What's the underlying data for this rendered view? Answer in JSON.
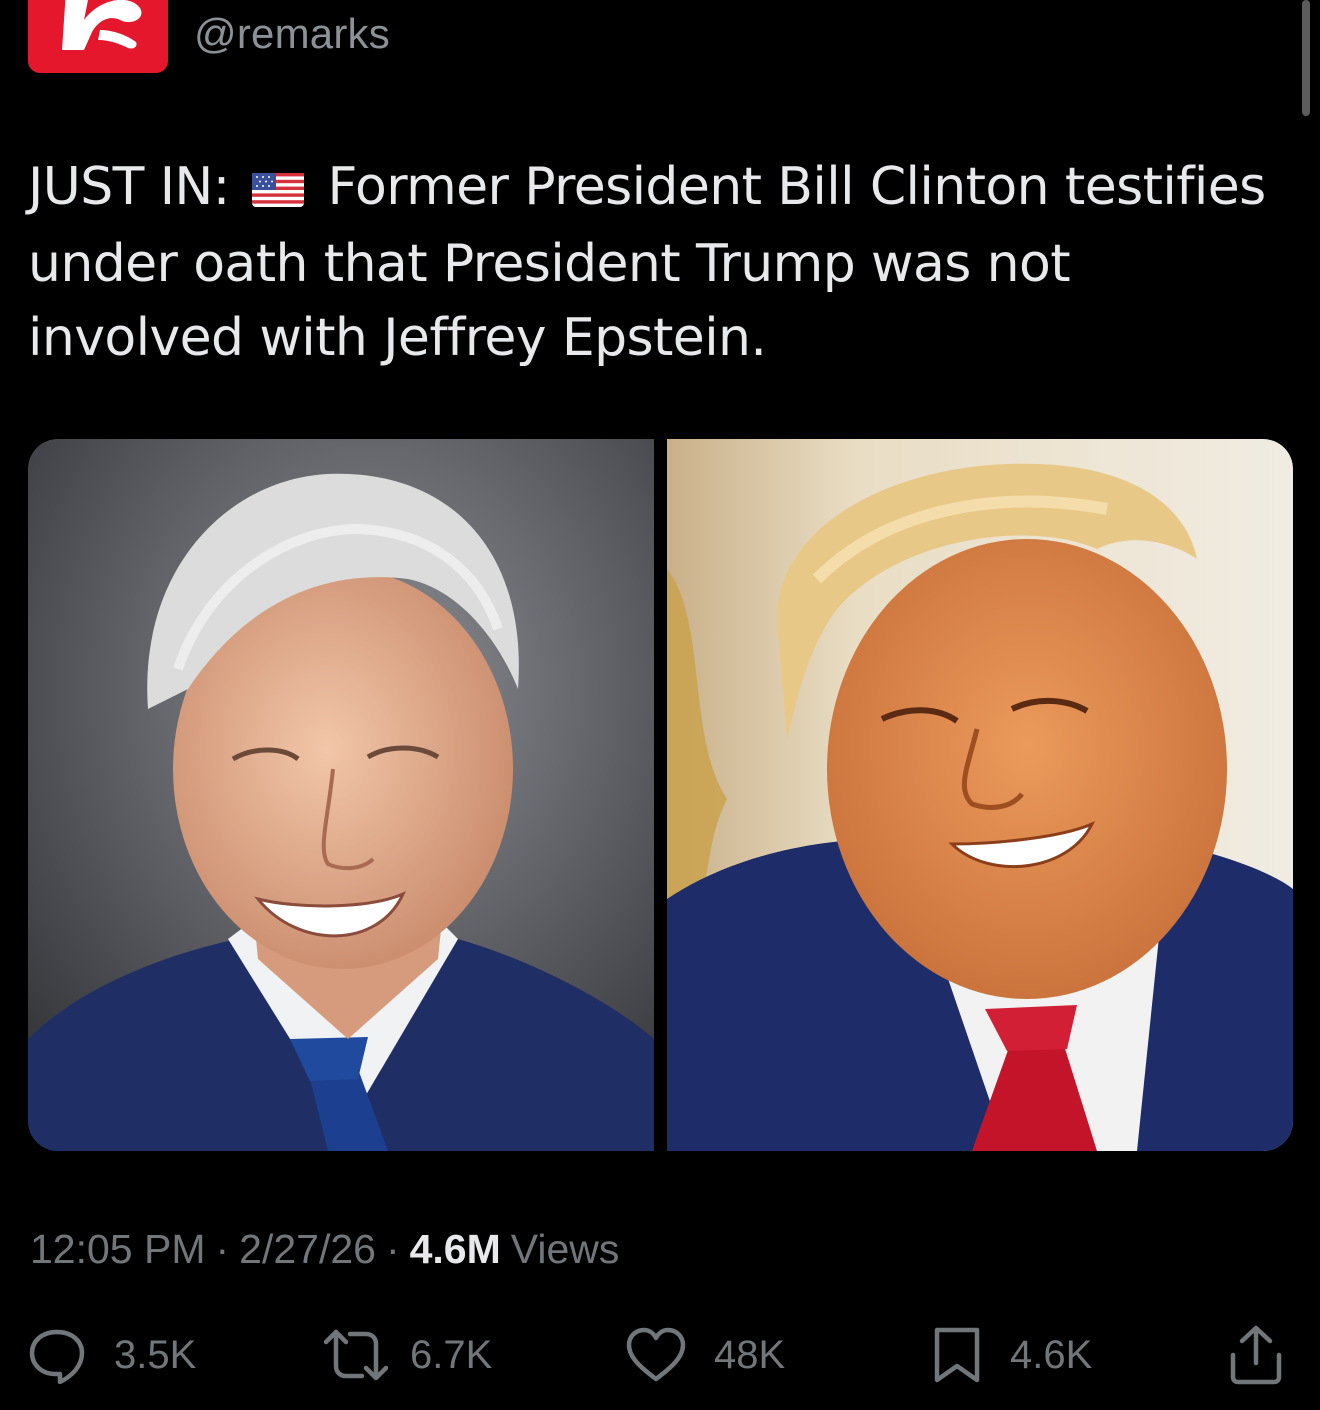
{
  "account": {
    "handle": "@remarks",
    "logo_letter": "R",
    "brand_color": "#e5172c"
  },
  "tweet": {
    "text_prefix": "JUST IN:",
    "flag_icon": "us-flag-emoji",
    "text_body": "Former President Bill Clinton testifies under oath that President Trump was not involved with Jeffrey Epstein."
  },
  "media": {
    "images": [
      {
        "name": "clinton-portrait"
      },
      {
        "name": "trump-portrait"
      }
    ]
  },
  "meta": {
    "time": "12:05 PM",
    "separator": "·",
    "date": "2/27/26",
    "views_count": "4.6M",
    "views_label": "Views"
  },
  "actions": {
    "replies": {
      "icon": "reply-icon",
      "count": "3.5K"
    },
    "reposts": {
      "icon": "repost-icon",
      "count": "6.7K"
    },
    "likes": {
      "icon": "like-icon",
      "count": "48K"
    },
    "bookmarks": {
      "icon": "bookmark-icon",
      "count": "4.6K"
    },
    "share": {
      "icon": "share-icon"
    }
  },
  "colors": {
    "background": "#000000",
    "text": "#e7e9ea",
    "muted": "#71767b"
  }
}
